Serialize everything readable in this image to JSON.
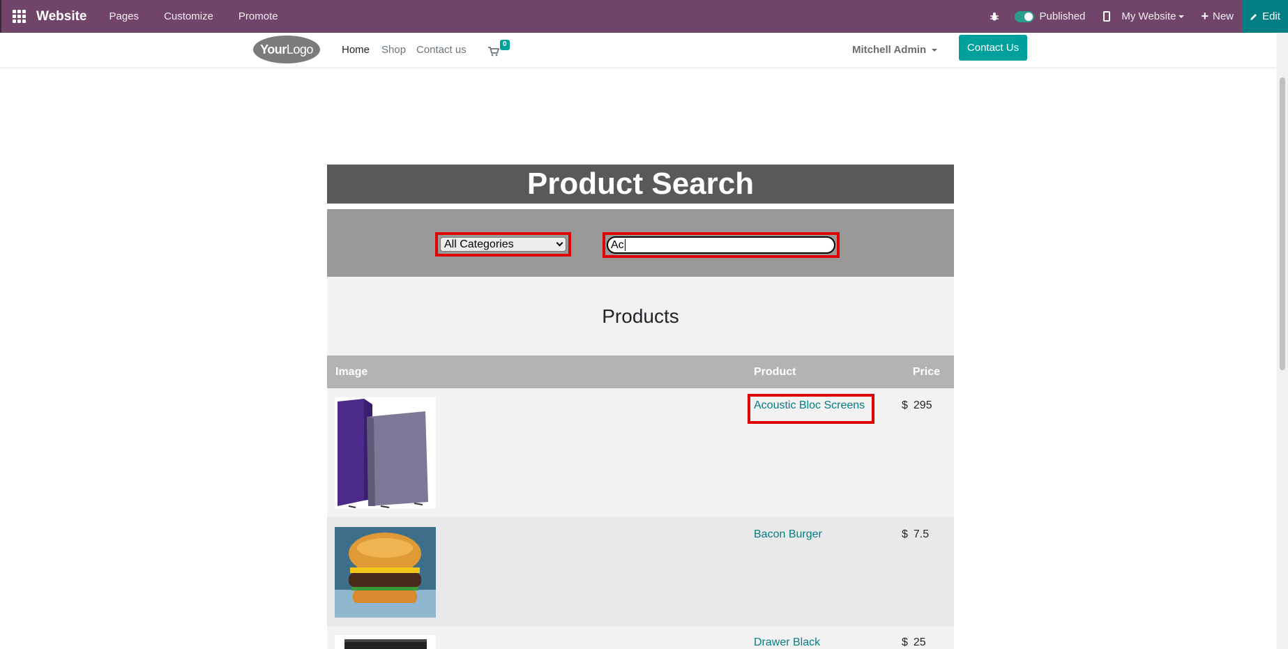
{
  "adminbar": {
    "brand": "Website",
    "menu": [
      "Pages",
      "Customize",
      "Promote"
    ],
    "published_label": "Published",
    "site_selector": "My Website",
    "new_label": "New",
    "edit_label": "Edit",
    "bg_color": "#71456a",
    "edit_color": "#017e84"
  },
  "header": {
    "logo_text_bold": "Your",
    "logo_text": "Logo",
    "nav": [
      "Home",
      "Shop",
      "Contact us"
    ],
    "cart_count": "0",
    "user_name": "Mitchell Admin",
    "contact_button": "Contact Us",
    "accent_color": "#00a09d"
  },
  "search": {
    "title": "Product Search",
    "category_selected": "All Categories",
    "query": "Ac"
  },
  "products": {
    "heading": "Products",
    "columns": [
      "Image",
      "Product",
      "Price"
    ],
    "rows": [
      {
        "name": "Acoustic Bloc Screens",
        "currency": "$",
        "price": "295"
      },
      {
        "name": "Bacon Burger",
        "currency": "$",
        "price": "7.5"
      },
      {
        "name": "Drawer Black",
        "currency": "$",
        "price": "25"
      }
    ]
  }
}
